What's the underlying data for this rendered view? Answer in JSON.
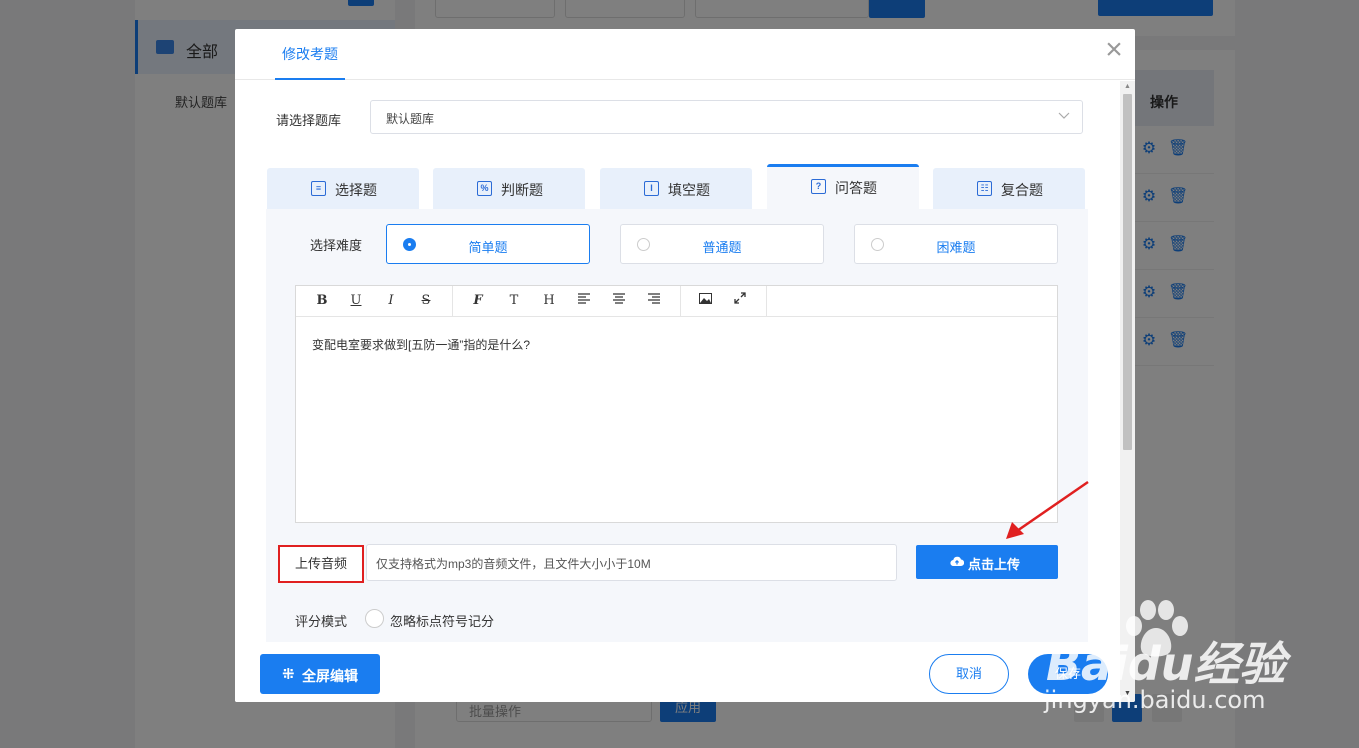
{
  "background": {
    "sidebar": {
      "all_label": "全部",
      "default_bank": "默认题库"
    },
    "table": {
      "operation_header": "操作"
    },
    "bottom": {
      "batch_placeholder": "批量操作",
      "apply_label": "应用"
    }
  },
  "modal": {
    "tab_label": "修改考题",
    "bank": {
      "label": "请选择题库",
      "value": "默认题库"
    },
    "question_types": [
      {
        "label": "选择题",
        "icon": "list-icon"
      },
      {
        "label": "判断题",
        "icon": "percent-icon"
      },
      {
        "label": "填空题",
        "icon": "text-cursor-icon"
      },
      {
        "label": "问答题",
        "icon": "question-icon"
      },
      {
        "label": "复合题",
        "icon": "compound-icon"
      }
    ],
    "active_type": "问答题",
    "difficulty": {
      "label": "选择难度",
      "options": [
        "简单题",
        "普通题",
        "困难题"
      ],
      "selected": "简单题"
    },
    "editor": {
      "toolbar": [
        "B",
        "U",
        "I",
        "S",
        "F",
        "T",
        "H",
        "align-left",
        "align-center",
        "align-right",
        "image",
        "fullscreen"
      ],
      "content": "变配电室要求做到[五防一通”指的是什么?"
    },
    "upload": {
      "label": "上传音频",
      "placeholder": "仅支持格式为mp3的音频文件，且文件大小小于10M",
      "button_label": "点击上传"
    },
    "scoring": {
      "label": "评分模式",
      "option": "忽略标点符号记分"
    },
    "footer": {
      "fullscreen_label": "全屏编辑",
      "cancel_label": "取消",
      "save_label": "保存"
    }
  },
  "watermark": {
    "brand": "Baidu经验",
    "url": "jingyan.baidu.com"
  },
  "colors": {
    "accent": "#1a7df0",
    "highlight_border": "#e02020",
    "arrow": "#e02020"
  }
}
